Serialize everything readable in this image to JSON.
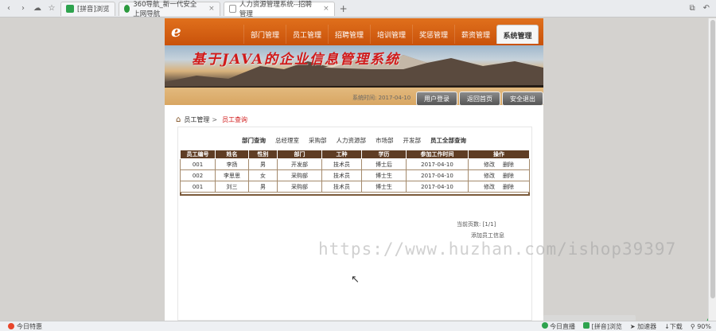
{
  "browser": {
    "tabs": [
      {
        "label": "[拼音]浏览",
        "active": false
      },
      {
        "label": "360导航_新一代安全上网导航",
        "active": false
      },
      {
        "label": "人力资源管理系统--招聘管理",
        "active": true
      }
    ],
    "status": {
      "left": "今日特惠",
      "items": [
        "今日直播",
        "[拼音]浏览",
        "加速器",
        "下载",
        "90%"
      ]
    }
  },
  "app": {
    "menu": [
      {
        "label": "部门管理"
      },
      {
        "label": "员工管理"
      },
      {
        "label": "招聘管理"
      },
      {
        "label": "培训管理"
      },
      {
        "label": "奖惩管理"
      },
      {
        "label": "薪资管理"
      },
      {
        "label": "系统管理",
        "active": true
      }
    ],
    "banner_title": "基于JAVA的企业信息管理系统",
    "system_date": "系统时间: 2017-04-10",
    "sub_buttons": [
      "用户登录",
      "返回首页",
      "安全退出"
    ],
    "breadcrumb": {
      "parent": "员工管理",
      "current": "员工查询"
    },
    "dept_filter": {
      "label": "部门查询",
      "items": [
        "总经理室",
        "采购部",
        "人力资源部",
        "市场部",
        "开发部"
      ],
      "all": "员工全部查询"
    },
    "table": {
      "headers": [
        "员工编号",
        "姓名",
        "性别",
        "部门",
        "工种",
        "学历",
        "参加工作时间",
        "操作"
      ],
      "rows": [
        [
          "001",
          "李扬",
          "男",
          "开发部",
          "技术员",
          "博士后",
          "2017-04-10"
        ],
        [
          "002",
          "李思思",
          "女",
          "采购部",
          "技术员",
          "博士生",
          "2017-04-10"
        ],
        [
          "001",
          "刘三",
          "男",
          "采购部",
          "技术员",
          "博士生",
          "2017-04-10"
        ]
      ],
      "actions": [
        "修改",
        "删除"
      ]
    },
    "pager": "当前页数: [1/1]",
    "add_link": "添加员工信息"
  },
  "watermark": "https://www.huzhan.com/ishop39397"
}
